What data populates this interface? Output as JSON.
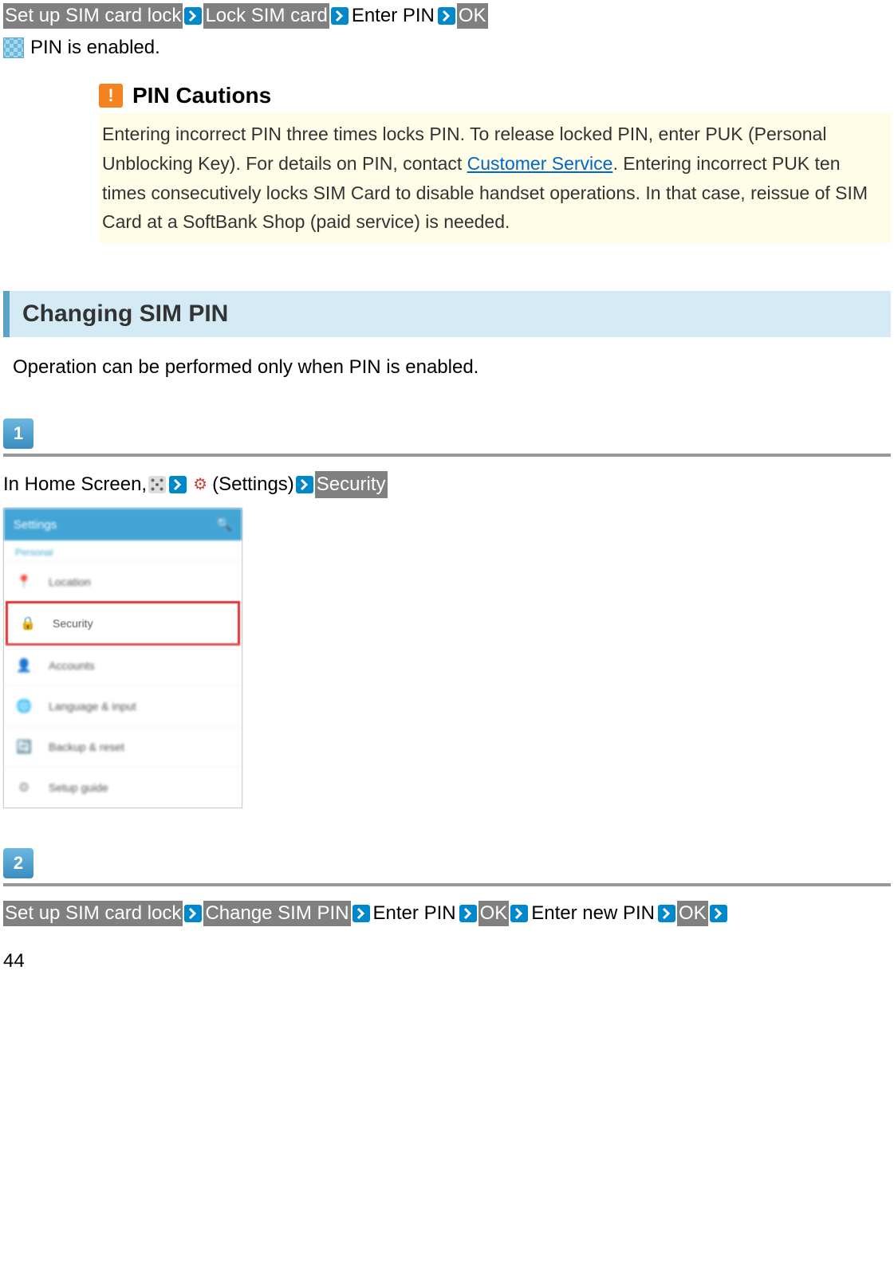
{
  "topBreadcrumb": {
    "items": [
      "Set up SIM card lock",
      "Lock SIM card",
      "Enter PIN",
      "OK"
    ],
    "plainIndices": [
      2
    ]
  },
  "resultLine": "PIN is enabled.",
  "caution": {
    "title": "PIN Cautions",
    "bodyBefore": "Entering incorrect PIN three times locks PIN. To release locked PIN, enter PUK (Personal Unblocking Key). For details on PIN, contact ",
    "link": "Customer Service",
    "bodyAfter": ". Entering incorrect PUK ten times consecutively locks SIM Card to disable handset operations. In that case, reissue of SIM Card at a SoftBank Shop (paid service) is needed."
  },
  "sectionHeader": "Changing SIM PIN",
  "sectionNote": "Operation can be performed only when PIN is enabled.",
  "step1": {
    "number": "1",
    "prefix": "In Home Screen, ",
    "settingsLabel": " (Settings)",
    "securityLabel": "Security"
  },
  "step2": {
    "number": "2",
    "items": [
      "Set up SIM card lock",
      "Change SIM PIN",
      "Enter PIN",
      "OK",
      "Enter new PIN",
      "OK"
    ],
    "plainIndices": [
      2,
      4
    ]
  },
  "screenshot": {
    "headerTitle": "Settings",
    "sectionLabel": "Personal",
    "items": [
      {
        "icon": "📍",
        "iconColor": "#42a5d6",
        "label": "Location",
        "highlighted": false
      },
      {
        "icon": "🔒",
        "iconColor": "#f5a623",
        "label": "Security",
        "highlighted": true
      },
      {
        "icon": "👤",
        "iconColor": "#666",
        "label": "Accounts",
        "highlighted": false
      },
      {
        "icon": "🌐",
        "iconColor": "#666",
        "label": "Language & input",
        "highlighted": false
      },
      {
        "icon": "🔄",
        "iconColor": "#42a5d6",
        "label": "Backup & reset",
        "highlighted": false
      },
      {
        "icon": "⚙",
        "iconColor": "#888",
        "label": "Setup guide",
        "highlighted": false
      }
    ]
  },
  "pageNumber": "44"
}
